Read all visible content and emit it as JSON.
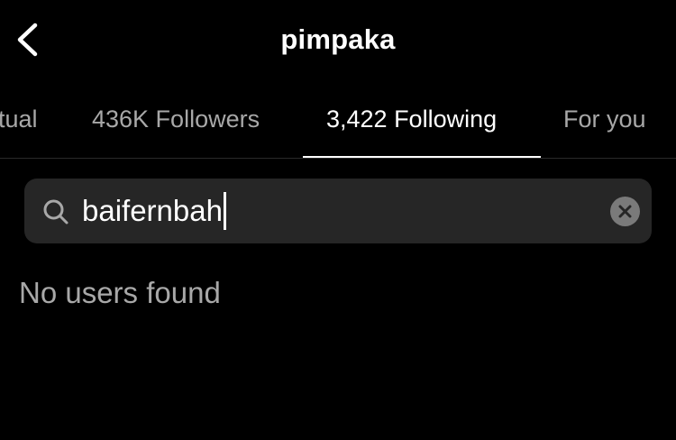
{
  "header": {
    "back_icon": "chevron-left-icon",
    "title": "pimpaka"
  },
  "tabs": [
    {
      "label": "tual",
      "active": false
    },
    {
      "label": "436K Followers",
      "active": false
    },
    {
      "label": "3,422 Following",
      "active": true
    },
    {
      "label": "For you",
      "active": false
    }
  ],
  "search": {
    "icon": "search-icon",
    "value": "baifernbah",
    "clear_icon": "clear-icon"
  },
  "results": {
    "empty_message": "No users found"
  },
  "colors": {
    "background": "#000000",
    "text_primary": "#ffffff",
    "text_secondary": "#a8a8a8",
    "search_background": "#262626",
    "clear_button": "#7a7a7a"
  }
}
